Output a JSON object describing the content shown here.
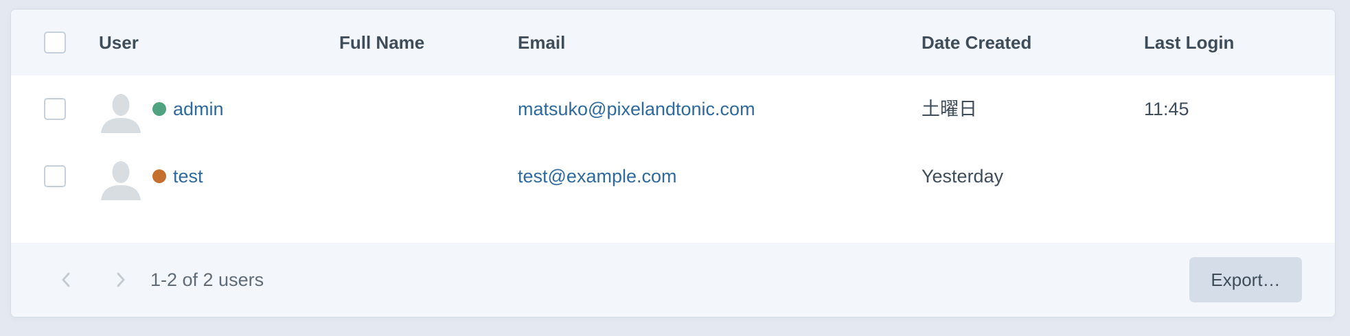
{
  "table": {
    "columns": {
      "user": "User",
      "full_name": "Full Name",
      "email": "Email",
      "date_created": "Date Created",
      "last_login": "Last Login"
    },
    "rows": [
      {
        "username": "admin",
        "full_name": "",
        "email": "matsuko@pixelandtonic.com",
        "date_created": "土曜日",
        "last_login": "11:45",
        "status": "active",
        "status_color": "#4fa37e"
      },
      {
        "username": "test",
        "full_name": "",
        "email": "test@example.com",
        "date_created": "Yesterday",
        "last_login": "",
        "status": "pending",
        "status_color": "#c46f2e"
      }
    ]
  },
  "footer": {
    "count_text": "1-2 of 2 users",
    "export_label": "Export…",
    "prev_icon": "chevron-left-icon",
    "next_icon": "chevron-right-icon"
  },
  "colors": {
    "link": "#2e6aa0",
    "header_bg": "#f3f7fb",
    "page_bg": "#e4e9f1",
    "export_bg": "#d5dee8"
  }
}
